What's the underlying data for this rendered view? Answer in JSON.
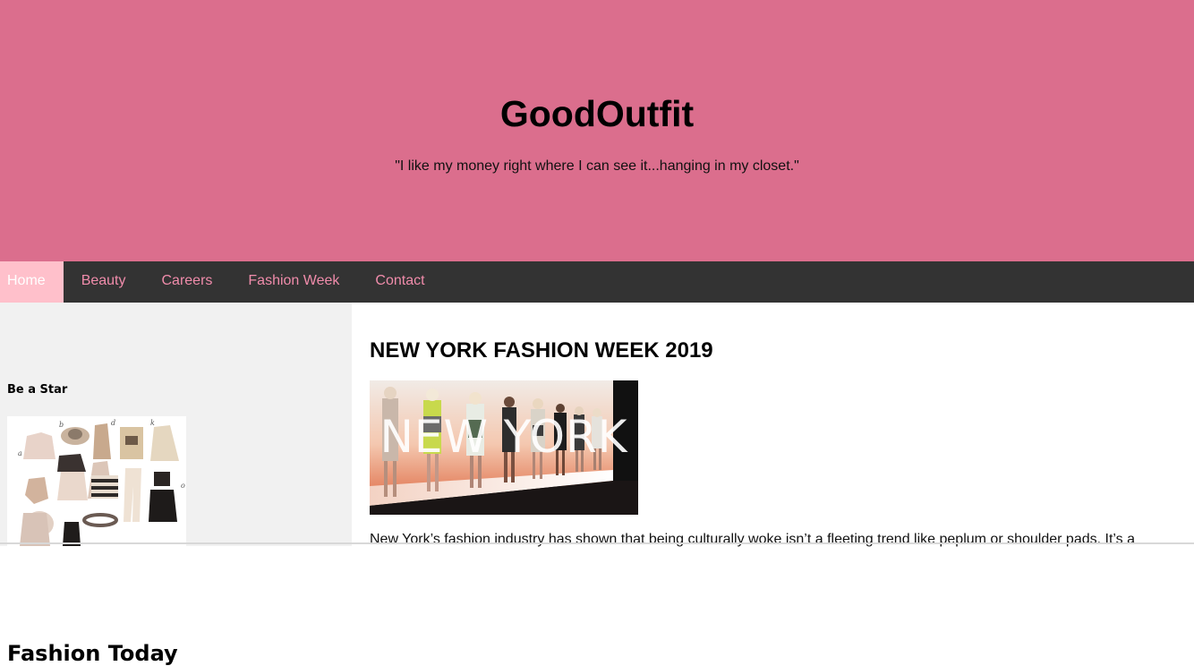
{
  "header": {
    "title": "GoodOutfit",
    "tagline": "\"I like my money right where I can see it...hanging in my closet.\""
  },
  "nav": {
    "items": [
      {
        "label": "Home"
      },
      {
        "label": "Beauty"
      },
      {
        "label": "Careers"
      },
      {
        "label": "Fashion Week"
      },
      {
        "label": "Contact"
      }
    ]
  },
  "sidebar": {
    "title": "Fashion Today",
    "subtitle": "Be a Star"
  },
  "main": {
    "title": "NEW YORK FASHION WEEK 2019",
    "hero_label": "NEW YORK",
    "article_text": "New York’s fashion industry has shown that being culturally woke isn’t a fleeting trend like peplum or shoulder pads. It’s a"
  },
  "colors": {
    "header_bg": "#db6e8d",
    "nav_bg": "#333333",
    "nav_text": "#f08cab",
    "nav_active_bg": "#ffc0cb",
    "sidebar_bg": "#f1f1f1"
  }
}
